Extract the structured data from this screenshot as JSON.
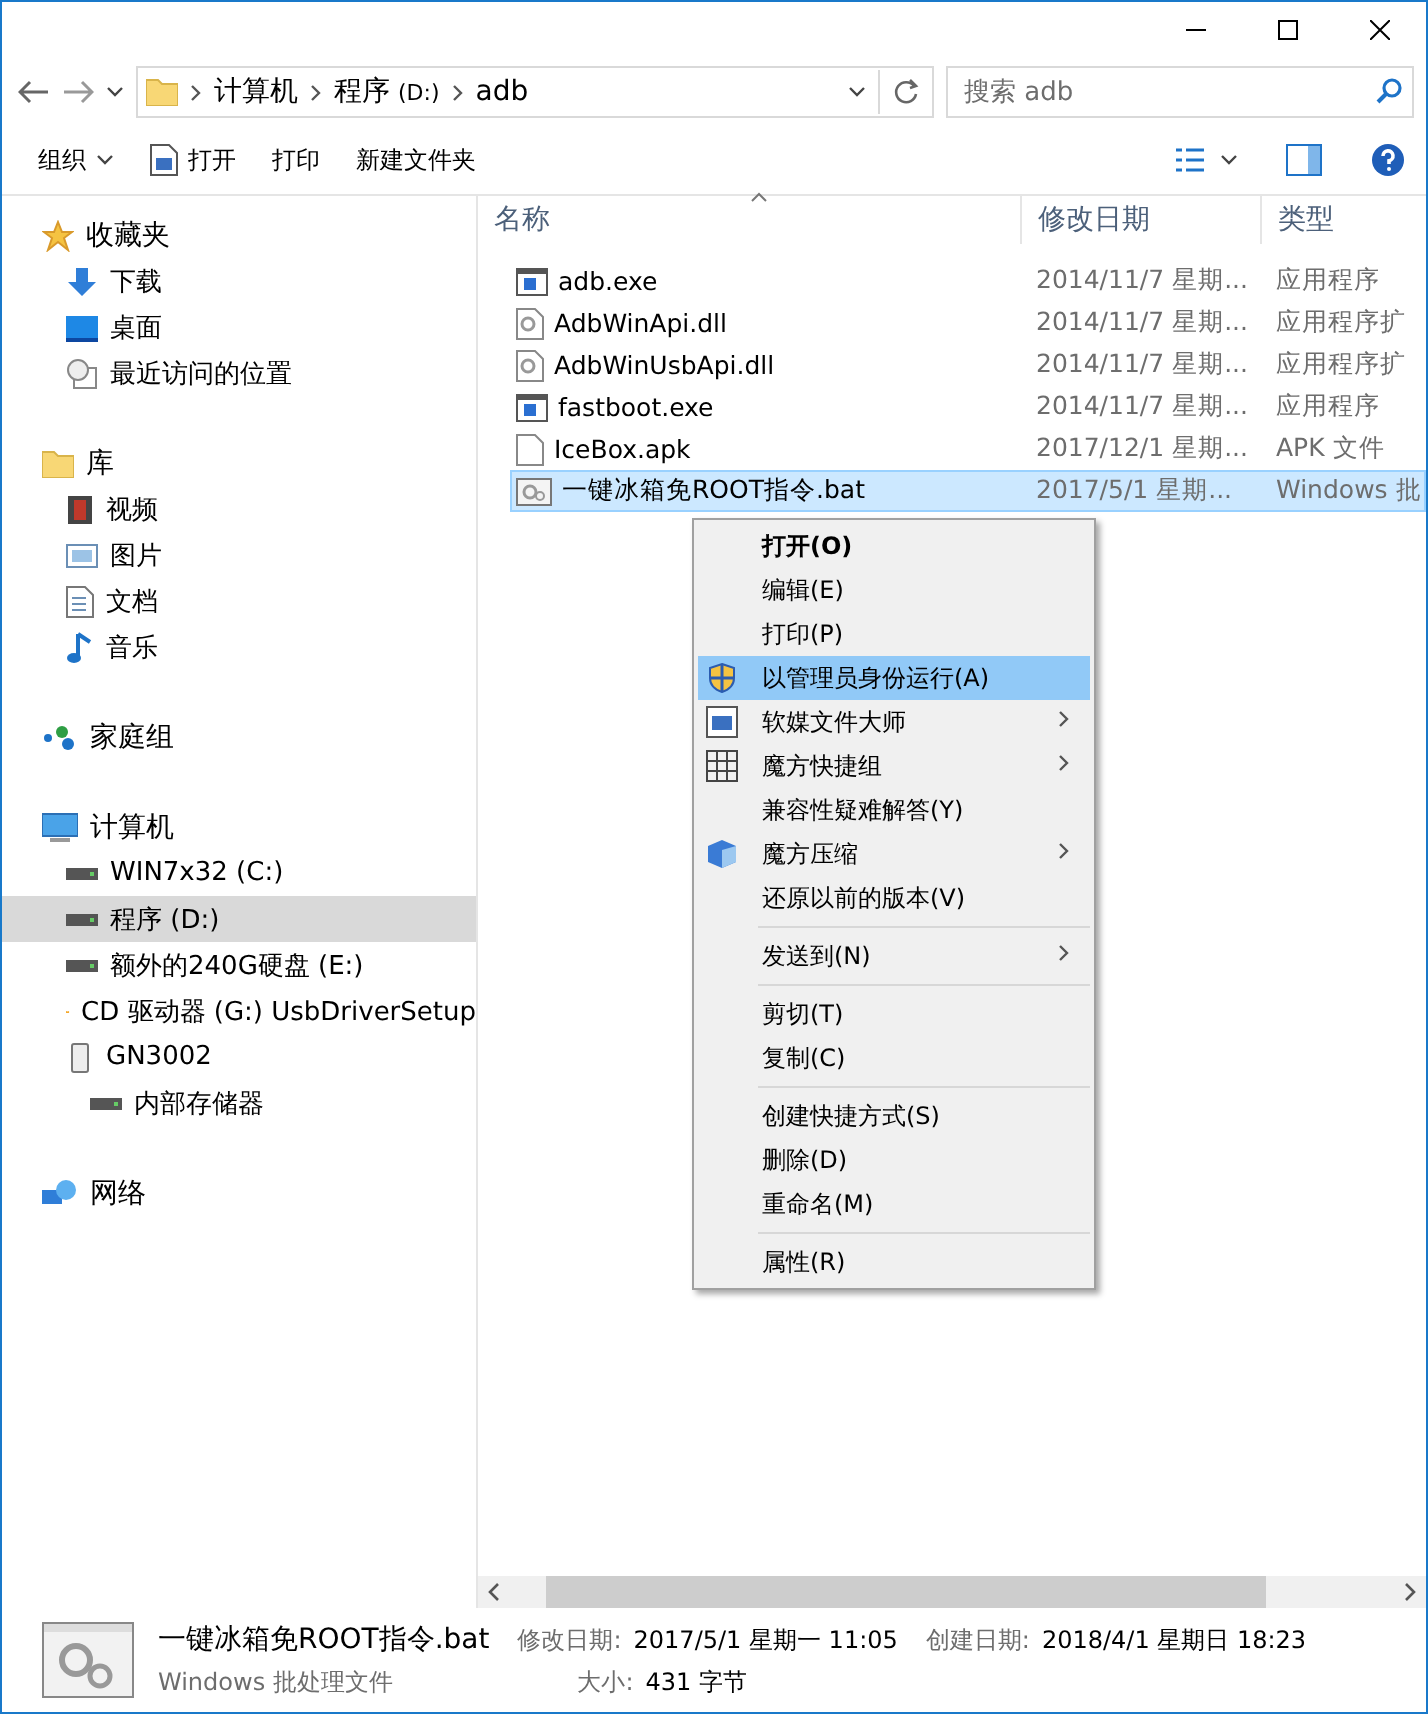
{
  "address": {
    "crumbs": [
      {
        "label": "计算机"
      },
      {
        "label": "程序",
        "suffix": "(D:)"
      },
      {
        "label": "adb"
      }
    ]
  },
  "search": {
    "placeholder": "搜索 adb"
  },
  "toolbar": [
    {
      "label": "组织",
      "dropdown": true
    },
    {
      "label": "打开",
      "dropdown": false
    },
    {
      "label": "打印",
      "dropdown": false
    },
    {
      "label": "新建文件夹",
      "dropdown": false
    }
  ],
  "nav": [
    {
      "label": "收藏夹",
      "selected": false,
      "children": [
        {
          "label": "下载",
          "selected": false
        },
        {
          "label": "桌面",
          "selected": false
        },
        {
          "label": "最近访问的位置",
          "selected": false
        }
      ]
    },
    {
      "label": "库",
      "selected": false,
      "children": [
        {
          "label": "视频",
          "selected": false
        },
        {
          "label": "图片",
          "selected": false
        },
        {
          "label": "文档",
          "selected": false
        },
        {
          "label": "音乐",
          "selected": false
        }
      ]
    },
    {
      "label": "家庭组",
      "selected": false
    },
    {
      "label": "计算机",
      "selected": false,
      "children": [
        {
          "label": "WIN7x32 (C:)",
          "selected": false
        },
        {
          "label": "程序 (D:)",
          "selected": true
        },
        {
          "label": "额外的240G硬盘 (E:)",
          "selected": false
        },
        {
          "label": "CD 驱动器 (G:) UsbDriverSetup",
          "selected": false
        },
        {
          "label": "GN3002",
          "selected": false,
          "children": [
            {
              "label": "内部存储器",
              "selected": false
            }
          ]
        }
      ]
    },
    {
      "label": "网络",
      "selected": false
    }
  ],
  "columns": [
    {
      "label": "名称",
      "sorted": true
    },
    {
      "label": "修改日期",
      "sorted": false
    },
    {
      "label": "类型",
      "sorted": false
    }
  ],
  "files": [
    {
      "name": "adb.exe",
      "date": "2014/11/7 星期...",
      "type": "应用程序",
      "selected": false
    },
    {
      "name": "AdbWinApi.dll",
      "date": "2014/11/7 星期...",
      "type": "应用程序扩",
      "selected": false
    },
    {
      "name": "AdbWinUsbApi.dll",
      "date": "2014/11/7 星期...",
      "type": "应用程序扩",
      "selected": false
    },
    {
      "name": "fastboot.exe",
      "date": "2014/11/7 星期...",
      "type": "应用程序",
      "selected": false
    },
    {
      "name": "IceBox.apk",
      "date": "2017/12/1 星期...",
      "type": "APK 文件",
      "selected": false
    },
    {
      "name": "一键冰箱免ROOT指令.bat",
      "date": "2017/5/1 星期...",
      "type": "Windows 批",
      "selected": true
    }
  ],
  "menu": [
    {
      "kind": "item",
      "label": "打开(O)",
      "default": true,
      "selected": false,
      "submenu": false
    },
    {
      "kind": "item",
      "label": "编辑(E)",
      "default": false,
      "selected": false,
      "submenu": false
    },
    {
      "kind": "item",
      "label": "打印(P)",
      "default": false,
      "selected": false,
      "submenu": false
    },
    {
      "kind": "item",
      "label": "以管理员身份运行(A)",
      "default": false,
      "selected": true,
      "submenu": false
    },
    {
      "kind": "item",
      "label": "软媒文件大师",
      "default": false,
      "selected": false,
      "submenu": true
    },
    {
      "kind": "item",
      "label": "魔方快捷组",
      "default": false,
      "selected": false,
      "submenu": true
    },
    {
      "kind": "item",
      "label": "兼容性疑难解答(Y)",
      "default": false,
      "selected": false,
      "submenu": false
    },
    {
      "kind": "item",
      "label": "魔方压缩",
      "default": false,
      "selected": false,
      "submenu": true
    },
    {
      "kind": "item",
      "label": "还原以前的版本(V)",
      "default": false,
      "selected": false,
      "submenu": false
    },
    {
      "kind": "separator"
    },
    {
      "kind": "item",
      "label": "发送到(N)",
      "default": false,
      "selected": false,
      "submenu": true
    },
    {
      "kind": "separator"
    },
    {
      "kind": "item",
      "label": "剪切(T)",
      "default": false,
      "selected": false,
      "submenu": false
    },
    {
      "kind": "item",
      "label": "复制(C)",
      "default": false,
      "selected": false,
      "submenu": false
    },
    {
      "kind": "separator"
    },
    {
      "kind": "item",
      "label": "创建快捷方式(S)",
      "default": false,
      "selected": false,
      "submenu": false
    },
    {
      "kind": "item",
      "label": "删除(D)",
      "default": false,
      "selected": false,
      "submenu": false
    },
    {
      "kind": "item",
      "label": "重命名(M)",
      "default": false,
      "selected": false,
      "submenu": false
    },
    {
      "kind": "separator"
    },
    {
      "kind": "item",
      "label": "属性(R)",
      "default": false,
      "selected": false,
      "submenu": false
    }
  ],
  "details": {
    "name": "一键冰箱免ROOT指令.bat",
    "type": "Windows 批处理文件",
    "fields": [
      {
        "label": "修改日期:",
        "value": "2017/5/1 星期一 11:05"
      },
      {
        "label": "创建日期:",
        "value": "2018/4/1 星期日 18:23"
      },
      {
        "label": "大小:",
        "value": "431 字节"
      }
    ]
  }
}
